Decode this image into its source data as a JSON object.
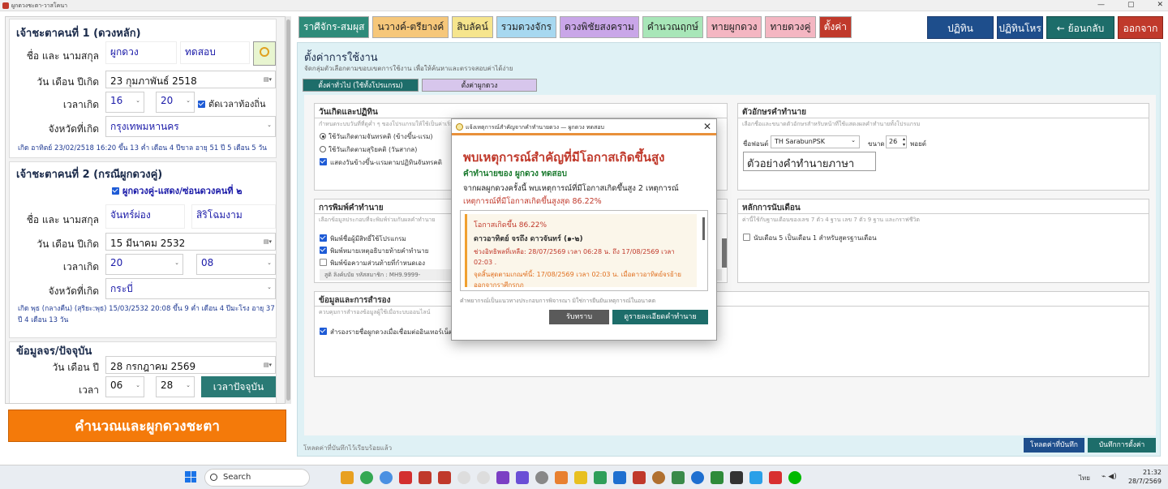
{
  "window": {
    "title": "ผูกดวงชะตา-วาสโคนา"
  },
  "left": {
    "person1": {
      "title": "เจ้าชะตาคนที่ 1 (ดวงหลัก)",
      "name_label": "ชื่อ และ นามสกุล",
      "first_name": "ผูกดวง",
      "last_name": "ทดสอบ",
      "dob_label": "วัน เดือน ปีเกิด",
      "dob": "23  กุมภาพันธ์   2518",
      "time_label": "เวลาเกิด",
      "hour": "16",
      "minute": "20",
      "local_time_label": "ตัดเวลาท้องถิ่น",
      "province_label": "จังหวัดที่เกิด",
      "province": "กรุงเทพมหานคร",
      "note": "เกิด อาทิตย์ 23/02/2518 16:20 ขึ้น 13 ค่ำ เดือน 4 ปีขาล อายุ 51 ปี 5 เดือน 5 วัน"
    },
    "person2": {
      "title": "เจ้าชะตาคนที่ 2 (กรณีผูกดวงคู่)",
      "pair_label": "ผูกดวงคู่-แสดง/ซ่อนดวงคนที่ ๒",
      "name_label": "ชื่อ และ นามสกุล",
      "first_name": "จันทร์ผ่อง",
      "last_name": "สิริโฉมงาม",
      "dob_label": "วัน เดือน ปีเกิด",
      "dob": "15     มีนาคม       2532",
      "time_label": "เวลาเกิด",
      "hour": "20",
      "minute": "08",
      "province_label": "จังหวัดที่เกิด",
      "province": "กระบี่",
      "note": "เกิด พุธ (กลางคืน) (สุริยะ:พุธ) 15/03/2532 20:08 ขึ้น 9 ค่ำ เดือน 4 ปีมะโรง อายุ 37 ปี 4 เดือน 13 วัน"
    },
    "current": {
      "title": "ข้อมูลจร/ปัจจุบัน",
      "date_label": "วัน เดือน ปี",
      "date": "28   กรกฎาคม     2569",
      "time_label": "เวลา",
      "hour": "06",
      "minute": "28",
      "now_button": "เวลาปัจจุบัน"
    },
    "calc_button": "คำนวณและผูกดวงชะตา"
  },
  "tabs": [
    {
      "label": "ราศีจักร-สมผุส",
      "bg": "#2e8b7a",
      "fg": "#ffffff"
    },
    {
      "label": "นวางค์-ตรียางค์",
      "bg": "#f6c77a",
      "fg": "#222222"
    },
    {
      "label": "สิบลัคน์",
      "bg": "#f6e58d",
      "fg": "#222222"
    },
    {
      "label": "รวมดวงจักร",
      "bg": "#a7d8f0",
      "fg": "#222222"
    },
    {
      "label": "ดวงพิชัยสงคราม",
      "bg": "#c9a6e8",
      "fg": "#222222"
    },
    {
      "label": "คำนวณฤกษ์",
      "bg": "#a8e6b8",
      "fg": "#222222"
    },
    {
      "label": "ทายผูกดวง",
      "bg": "#f4b6c2",
      "fg": "#222222"
    },
    {
      "label": "ทายดวงคู่",
      "bg": "#f4b6c2",
      "fg": "#222222"
    },
    {
      "label": "ตั้งค่า",
      "bg": "#c0392b",
      "fg": "#ffffff"
    }
  ],
  "top_buttons": {
    "calendar": "ปฏิทิน",
    "astro_calendar": "ปฏิทินโหร",
    "back": "← ย้อนกลับ",
    "exit": "ออกจาก"
  },
  "settings": {
    "title": "ตั้งค่าการใช้งาน",
    "subtitle": "จัดกลุ่มตัวเลือกตามขอบเขตการใช้งาน เพื่อให้ค้นหาและตรวจสอบค่าได้ง่าย",
    "subtab_general": "ตั้งค่าทั่วไป (ใช้ทั้งโปรแกรม)",
    "subtab_chart": "ตั้งค่าผูกดวง",
    "panel_calendar": {
      "title": "วันเกิดและปฏิทิน",
      "desc": "กำหนดระบบวันที่ที่ดูค่ำ ๆ ของโปรแกรมให้ใช้เป็นค่าเริ่มต้น",
      "opt1": "ใช้วันเกิดตามจันทรคติ (ข้างขึ้น-แรม)",
      "opt2": "ใช้วันเกิดตามสุริยคติ (วันสากล)",
      "opt3": "แสดงวันข้างขึ้น-แรมตามปฏิทินจันทรคติ"
    },
    "panel_font": {
      "title": "ตัวอักษรคำทำนาย",
      "desc": "เลือกชื่อและขนาดตัวอักษรสำหรับหน้าที่ใช้แสดงผลคำทำนายทั้งโปรแกรม",
      "font_label": "ชื่อฟอนต์",
      "font_value": "TH SarabunPSK",
      "size_label": "ขนาด",
      "size_value": "26",
      "unit": "พอยต์",
      "sample": "ตัวอย่างคำทำนายภาษา"
    },
    "panel_print": {
      "title": "การพิมพ์คำทำนาย",
      "desc": "เลือกข้อมูลประกอบที่จะพิมพ์ร่วมกับผลคำทำนาย",
      "opt1": "พิมพ์ชื่อผู้มีสิทธิ์ใช้โปรแกรม",
      "opt2": "พิมพ์หมายเหตุอธิบายท้ายคำทำนาย",
      "opt3": "พิมพ์ข้อความส่วนท้ายที่กำหนดเอง",
      "footer": "สูติ    ลิงค์บบัย  รหัสสมาชิก : MH9.9999-"
    },
    "panel_month": {
      "title": "หลักการนับเดือน",
      "desc": "ค่านี้ใช้กับฐานเดือนของเลข 7 ตัว 4 ฐาน เลข 7 ตัว 9 ฐาน และกราฟชีวิต",
      "opt1": "นับเดือน 5 เป็นเดือน 1 สำหรับสูตรฐานเดือน"
    },
    "panel_data": {
      "title": "ข้อมูลและการสำรอง",
      "desc": "ควบคุมการสำรองข้อมูลผู้ใช้เมื่อระบบออนไลน์",
      "opt1": "สำรองรายชื่อผูกดวงเมื่อเชื่อมต่ออินเทอร์เน็ต"
    },
    "status": "โหลดค่าที่บันทึกไว้เรียบร้อยแล้ว",
    "load_button": "โหลดค่าที่บันทึก",
    "save_button": "บันทึกการตั้งค่า"
  },
  "modal": {
    "title": "แจ้งเหตุการณ์สำคัญจากคำทำนายดวง — ผูกดวง ทดสอบ",
    "heading": "พบเหตุการณ์สำคัญที่มีโอกาสเกิดขึ้นสูง",
    "prediction_of": "คำทำนายของ ผูกดวง ทดสอบ",
    "summary": "จากผลผูกดวงครั้งนี้ พบเหตุการณ์ที่มีโอกาสเกิดขึ้นสูง 2 เหตุการณ์",
    "highest": "เหตุการณ์ที่มีโอกาสเกิดขึ้นสูงสุด 86.22%",
    "item_chance": "โอกาสเกิดขึ้น 86.22%",
    "item_title": "ดาวอาทิตย์ จรถึง ดาวจันทร์ (๑-๒)",
    "item_period": "ช่วงอิทธิพลที่เหลือ: 28/07/2569 เวลา 06:28 น. ถึง 17/08/2569 เวลา 02:03 .",
    "item_end": "จุดสิ้นสุดตามเกณฑ์นี้: 17/08/2569 เวลา 02:03 น. เมื่อดาวอาทิตย์จรย้ายออกจากราศีกรกฎ",
    "footer": "คำพยากรณ์เป็นแนวทางประกอบการพิจารณา มิใช่การยืนยันเหตุการณ์ในอนาคต",
    "ack_button": "รับทราบ",
    "detail_button": "ดูรายละเอียดคำทำนาย"
  },
  "taskbar": {
    "search_placeholder": "Search",
    "lang": "ไทย",
    "time": "21:32",
    "date": "28/7/2569"
  }
}
